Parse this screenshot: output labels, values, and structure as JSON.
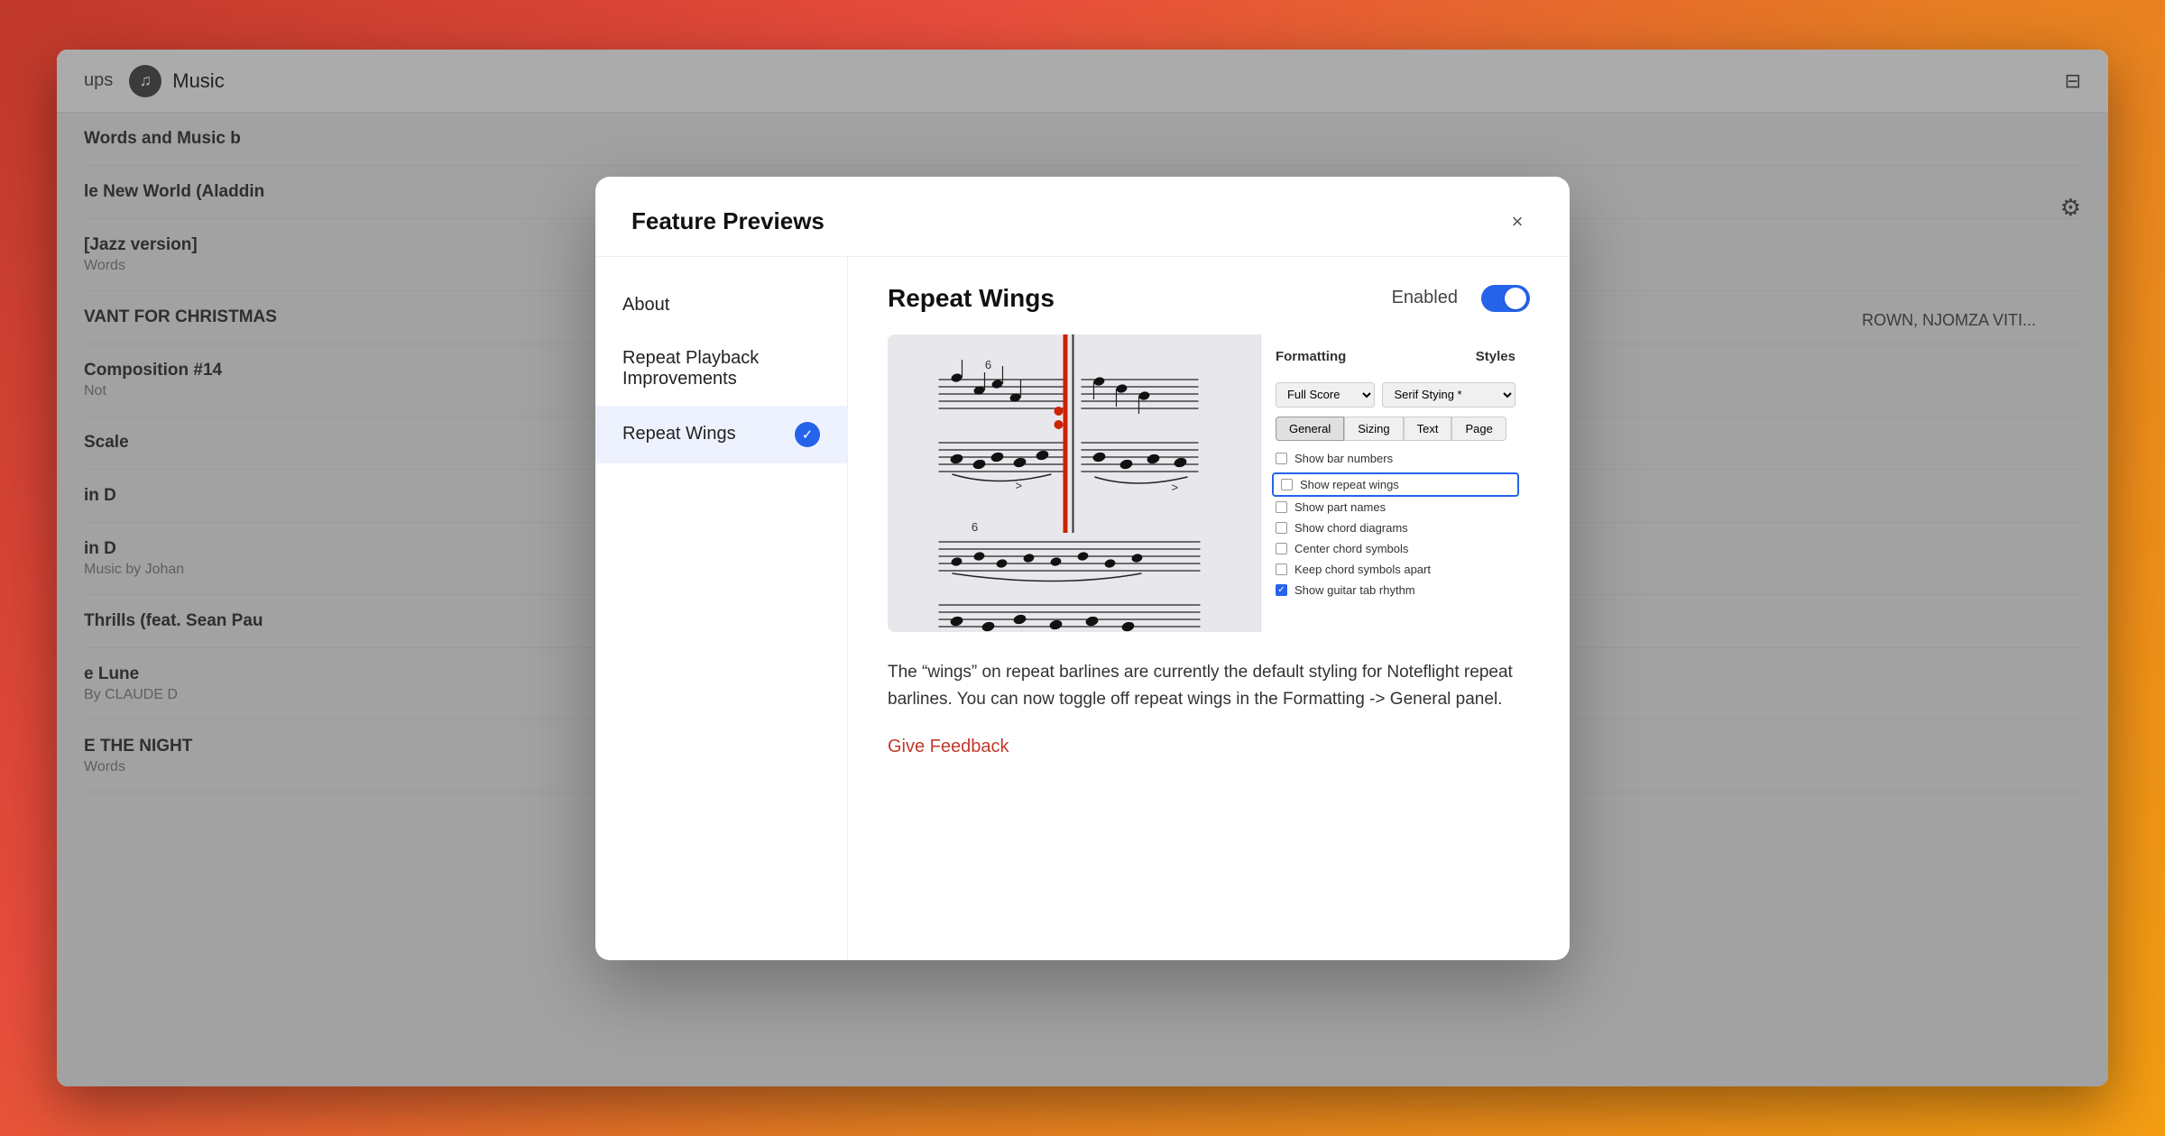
{
  "app": {
    "title": "Music",
    "header_left": "ups",
    "filter_icon": "⊟",
    "settings_icon": "⚙",
    "list_items": [
      {
        "title": "Words and Music b",
        "subtitle": ""
      },
      {
        "title": "New World (Aladdin",
        "subtitle": ""
      },
      {
        "title": "[Jazz version]",
        "subtitle": "Words"
      },
      {
        "title": "VANT FOR CHRISTMAS",
        "subtitle": ""
      },
      {
        "title": "Composition #14",
        "subtitle": "Not"
      },
      {
        "title": "Scale",
        "subtitle": ""
      },
      {
        "title": "in D",
        "subtitle": ""
      },
      {
        "title": "in D",
        "subtitle": "Music by Johan"
      },
      {
        "title": "Thrills (feat. Sean Pau",
        "subtitle": ""
      },
      {
        "title": "e Lune",
        "subtitle": "By CLAUDE D"
      },
      {
        "title": "E THE NIGHT",
        "subtitle": "Words"
      }
    ]
  },
  "modal": {
    "title": "Feature Previews",
    "close_label": "×",
    "sidebar": {
      "items": [
        {
          "id": "about",
          "label": "About",
          "active": false
        },
        {
          "id": "repeat-playback",
          "label": "Repeat Playback Improvements",
          "active": false
        },
        {
          "id": "repeat-wings",
          "label": "Repeat Wings",
          "active": true,
          "checked": true
        }
      ]
    },
    "content": {
      "title": "Repeat Wings",
      "enabled_label": "Enabled",
      "toggle_on": true,
      "description": "The “wings” on repeat barlines are currently the default styling for Noteflight repeat barlines. You can now toggle off repeat wings in the Formatting -> General panel.",
      "give_feedback_label": "Give Feedback",
      "preview": {
        "formatting_title": "Formatting",
        "styles_title": "Styles",
        "score_label": "Full Score",
        "style_label": "Serif Stying *",
        "tabs": [
          "General",
          "Sizing",
          "Text",
          "Page"
        ],
        "active_tab": "General",
        "checkboxes": [
          {
            "label": "Show bar numbers",
            "checked": false,
            "highlighted": false
          },
          {
            "label": "Show repeat wings",
            "checked": false,
            "highlighted": true
          },
          {
            "label": "Show part names",
            "checked": false,
            "highlighted": false
          },
          {
            "label": "Show chord diagrams",
            "checked": false,
            "highlighted": false
          },
          {
            "label": "Center chord symbols",
            "checked": false,
            "highlighted": false
          },
          {
            "label": "Keep chord symbols apart",
            "checked": false,
            "highlighted": false
          },
          {
            "label": "Show guitar tab rhythm",
            "checked": true,
            "highlighted": false
          }
        ]
      }
    }
  }
}
